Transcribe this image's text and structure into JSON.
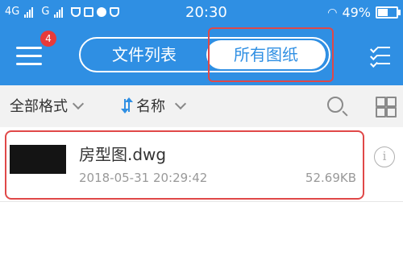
{
  "status_bar": {
    "carrier1": "4G",
    "carrier2": "G",
    "time": "20:30",
    "battery": "49%",
    "battery_level": 0.49
  },
  "app_bar": {
    "badge_count": "4",
    "tabs": [
      {
        "label": "文件列表",
        "selected": false
      },
      {
        "label": "所有图纸",
        "selected": true
      }
    ],
    "accent": "#2f8fe3"
  },
  "filter_bar": {
    "format_label": "全部格式",
    "sort_label": "名称"
  },
  "files": [
    {
      "name": "房型图.dwg",
      "date": "2018-05-31 20:29:42",
      "size": "52.69KB"
    }
  ],
  "icons": [
    "menu-icon",
    "checklist-icon",
    "search-icon",
    "grid-view-icon",
    "info-icon",
    "sort-icon"
  ]
}
